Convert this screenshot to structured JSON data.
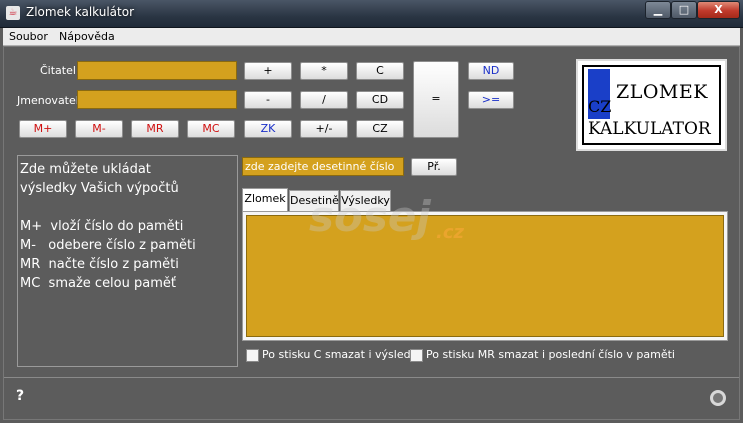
{
  "window": {
    "title": "Zlomek kalkulátor",
    "controls": {
      "minimize": "▁",
      "maximize": "□",
      "close": "X"
    }
  },
  "menu": [
    "Soubor",
    "Nápověda"
  ],
  "fields": {
    "numerator_label": "Čitatel",
    "denominator_label": "Jmenovatel"
  },
  "memory_buttons": [
    "M+",
    "M-",
    "MR",
    "MC"
  ],
  "operation_buttons": {
    "plus": "+",
    "multiply": "*",
    "clear": "C",
    "minus": "-",
    "divide": "/",
    "cd": "CD",
    "zk": "ZK",
    "plusminus": "+/-",
    "cz": "CZ",
    "equals": "=",
    "nd": "ND",
    "gte": ">="
  },
  "logo": {
    "cz": "CZ",
    "line1": "ZLOMEK",
    "line2": "KALKULATOR"
  },
  "memory_help": {
    "text": "Zde můžete ukládat\nvýsledky Vašich výpočtů\n\nM+  vloží číslo do paměti\nM-   odebere číslo z paměti\nMR  načte číslo z paměti\nMC  smaže celou paměť"
  },
  "decimal": {
    "input_value": "zde zadejte desetinné číslo",
    "convert_button": "Př."
  },
  "tabs": [
    "Zlomek",
    "Desetině",
    "Výsledky"
  ],
  "checkboxes": {
    "clear_on_c": "Po stisku C smazat i výsledky",
    "clear_on_mr": "Po stisku MR smazat i poslední číslo v paměti"
  },
  "status": {
    "help": "?"
  },
  "watermark": {
    "text": "sosej",
    "tld": ".cz"
  },
  "colors": {
    "field": "#d4a11e",
    "panel": "#5c5c5c",
    "memory_button_text": "#d01010",
    "accent_button_text": "#1a2fc8"
  }
}
